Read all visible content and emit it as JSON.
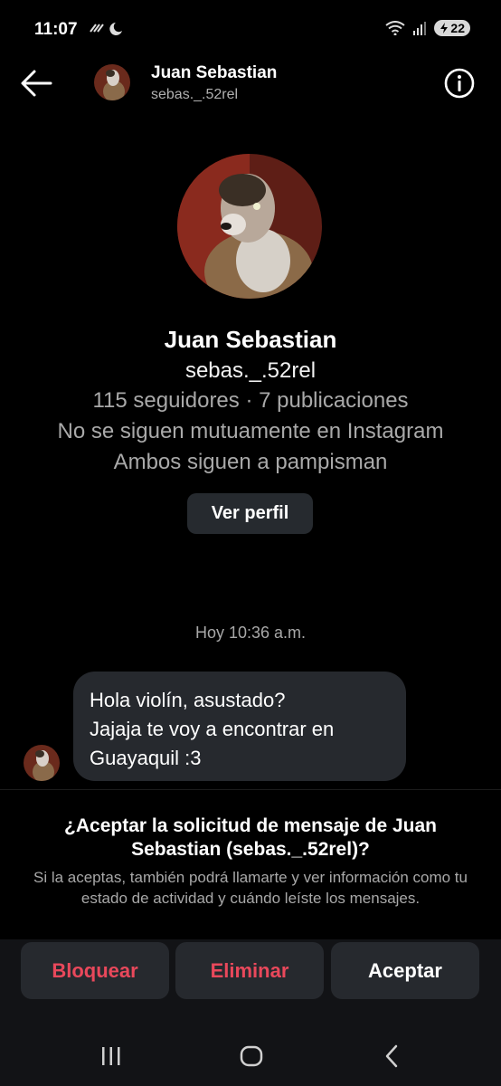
{
  "status_bar": {
    "time": "11:07",
    "battery": "22"
  },
  "header": {
    "name": "Juan Sebastian",
    "username": "sebas._.52rel",
    "back_icon": "arrow-left-icon",
    "info_icon": "info-circle-icon"
  },
  "profile": {
    "name": "Juan Sebastian",
    "username": "sebas._.52rel",
    "stats": "115 seguidores · 7 publicaciones",
    "mutual_status": "No se siguen mutuamente en Instagram",
    "mutual_follow": "Ambos siguen a pampisman",
    "view_profile_label": "Ver perfil"
  },
  "conversation": {
    "timestamp": "Hoy 10:36 a.m.",
    "messages": [
      {
        "text": "Hola violín, asustado?\nJajaja te voy a encontrar en\nGuayaquil :3"
      }
    ]
  },
  "request": {
    "title": "¿Aceptar la solicitud de mensaje de Juan Sebastian (sebas._.52rel)?",
    "description": "Si la aceptas, también podrá llamarte y ver información como tu estado de actividad y cuándo leíste los mensajes."
  },
  "actions": {
    "block": "Bloquear",
    "delete": "Eliminar",
    "accept": "Aceptar"
  },
  "colors": {
    "background": "#000000",
    "bubble": "#26292e",
    "danger": "#e9485b",
    "secondary_text": "#a8a8a8"
  }
}
